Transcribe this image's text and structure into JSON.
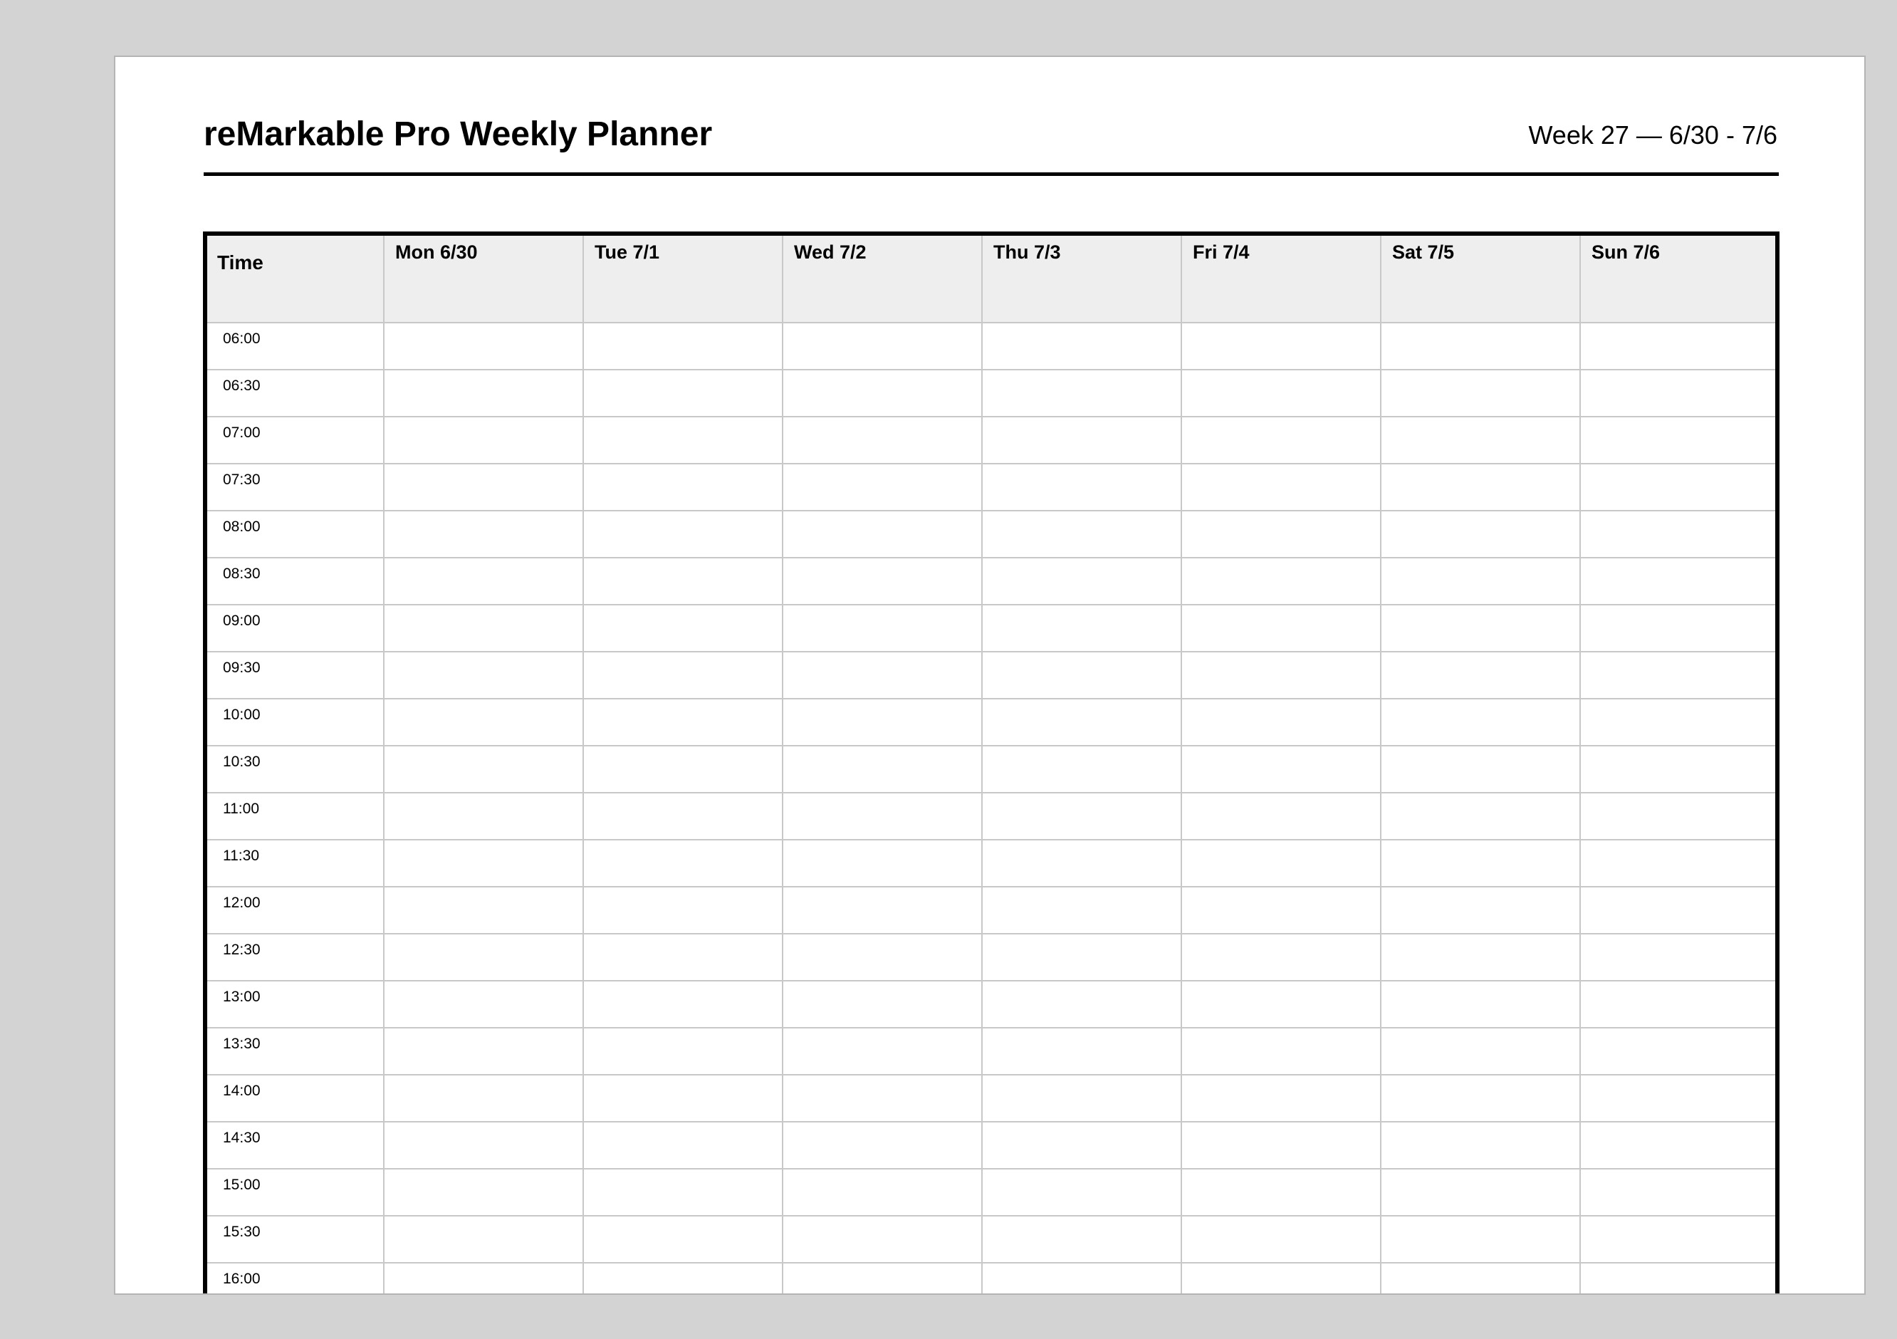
{
  "planner": {
    "title": "reMarkable Pro Weekly Planner",
    "week_label": "Week 27 — 6/30 - 7/6"
  },
  "table": {
    "time_header": "Time",
    "days": [
      "Mon 6/30",
      "Tue 7/1",
      "Wed 7/2",
      "Thu 7/3",
      "Fri 7/4",
      "Sat 7/5",
      "Sun 7/6"
    ],
    "times": [
      "06:00",
      "06:30",
      "07:00",
      "07:30",
      "08:00",
      "08:30",
      "09:00",
      "09:30",
      "10:00",
      "10:30",
      "11:00",
      "11:30",
      "12:00",
      "12:30",
      "13:00",
      "13:30",
      "14:00",
      "14:30",
      "15:00",
      "15:30",
      "16:00"
    ]
  },
  "colors": {
    "viewer_background": "#d3d3d3",
    "page_background": "#ffffff",
    "header_fill": "#eeeeee",
    "grid_line": "#c8c8c8",
    "frame": "#000000"
  }
}
